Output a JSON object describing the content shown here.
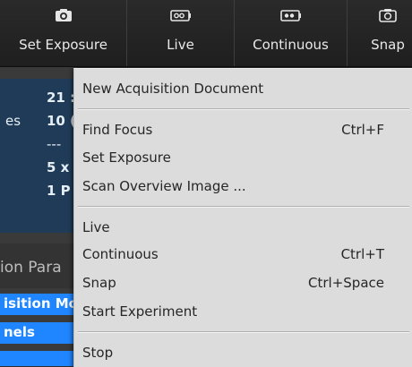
{
  "toolbar": {
    "buttons": [
      {
        "label": "Set Exposure",
        "icon": "camera-icon"
      },
      {
        "label": "Live",
        "icon": "live-icon"
      },
      {
        "label": "Continuous",
        "icon": "continuous-icon"
      },
      {
        "label": "Snap",
        "icon": "snap-camera-icon"
      }
    ]
  },
  "left_panel": {
    "summary_label": "es",
    "summary_values": [
      "21 :",
      "10 (",
      "---",
      "5 x",
      "1 P"
    ],
    "params_heading": "ion Para",
    "tabs": [
      "isition Mo",
      "nels"
    ]
  },
  "menu": {
    "items": [
      {
        "label": "New Acquisition Document",
        "shortcut": ""
      },
      {
        "label": "Find Focus",
        "shortcut": "Ctrl+F"
      },
      {
        "label": "Set Exposure",
        "shortcut": ""
      },
      {
        "label": "Scan Overview Image ...",
        "shortcut": ""
      },
      {
        "label": "Live",
        "shortcut": ""
      },
      {
        "label": "Continuous",
        "shortcut": "Ctrl+T"
      },
      {
        "label": "Snap",
        "shortcut": "Ctrl+Space"
      },
      {
        "label": "Start Experiment",
        "shortcut": ""
      },
      {
        "label": "Stop",
        "shortcut": ""
      }
    ]
  },
  "colors": {
    "toolbar_bg": "#242424",
    "menu_bg": "#dcdcdc",
    "accent_blue": "#1f86ff",
    "summary_bg": "#1f3b57"
  }
}
